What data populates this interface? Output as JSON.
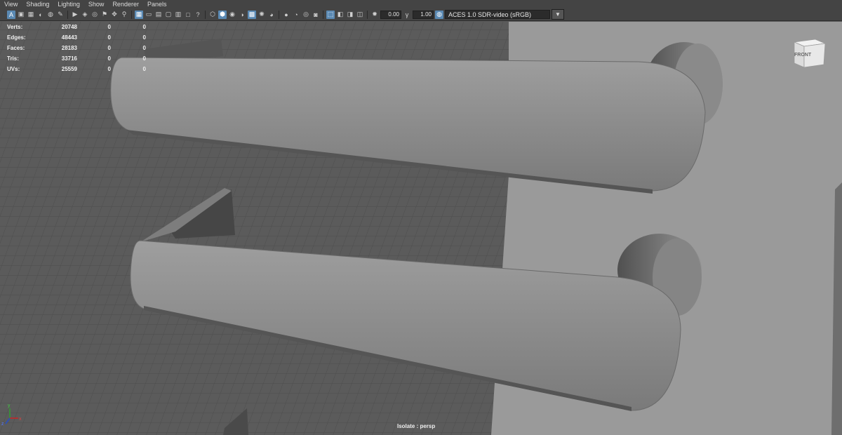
{
  "menu": [
    "View",
    "Shading",
    "Lighting",
    "Show",
    "Renderer",
    "Panels"
  ],
  "toolbar": {
    "exposure_value": "0.00",
    "gamma_value": "1.00",
    "color_space": "ACES 1.0 SDR-video (sRGB)"
  },
  "hud": {
    "rows": [
      {
        "label": "Verts:",
        "v1": "20748",
        "v2": "0",
        "v3": "0"
      },
      {
        "label": "Edges:",
        "v1": "48443",
        "v2": "0",
        "v3": "0"
      },
      {
        "label": "Faces:",
        "v1": "28183",
        "v2": "0",
        "v3": "0"
      },
      {
        "label": "Tris:",
        "v1": "33716",
        "v2": "0",
        "v3": "0"
      },
      {
        "label": "UVs:",
        "v1": "25559",
        "v2": "0",
        "v3": "0"
      }
    ]
  },
  "viewcube_label": "FRONT",
  "isolate_label": "Isolate : persp",
  "axis_labels": {
    "x": "x",
    "y": "y",
    "z": "z"
  },
  "colors": {
    "accent": "#5a89b3",
    "background": "#5a5a5a",
    "model": "#8f8f8f"
  }
}
